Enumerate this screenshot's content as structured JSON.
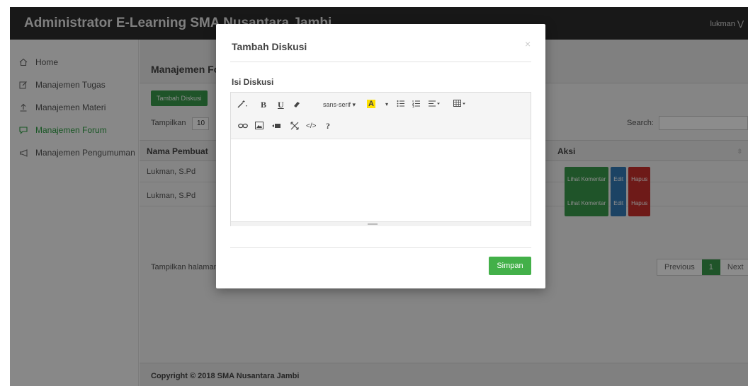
{
  "app": {
    "title": "Administrator E-Learning SMA Nusantara Jambi",
    "user": "lukman ⋁"
  },
  "sidebar": {
    "items": [
      {
        "label": "Home",
        "icon": "home-icon",
        "active": false
      },
      {
        "label": "Manajemen Tugas",
        "icon": "edit-icon",
        "active": false
      },
      {
        "label": "Manajemen Materi",
        "icon": "upload-icon",
        "active": false
      },
      {
        "label": "Manajemen Forum",
        "icon": "forum-icon",
        "active": true
      },
      {
        "label": "Manajemen Pengumuman",
        "icon": "megaphone-icon",
        "active": false
      }
    ]
  },
  "main": {
    "title": "Manajemen Forum",
    "add_button": "Tambah Diskusi",
    "length_label": "Tampilkan",
    "length_value": "10",
    "search_label": "Search:",
    "columns": [
      "Nama Pembuat",
      "Aksi"
    ],
    "rows": [
      {
        "nama": "Lukman, S.Pd"
      },
      {
        "nama": "Lukman, S.Pd"
      }
    ],
    "row_actions": {
      "comment": "Lihat Komentar",
      "edit": "Edit",
      "delete": "Hapus"
    },
    "info": "Tampilkan halaman",
    "pagination": {
      "prev": "Previous",
      "current": "1",
      "next": "Next"
    }
  },
  "footer": {
    "text": "Copyright © 2018 SMA Nusantara Jambi"
  },
  "modal": {
    "title": "Tambah Diskusi",
    "close": "×",
    "field_label": "Isi Diskusi",
    "font_name": "sans-serif ▾",
    "save_button": "Simpan"
  },
  "colors": {
    "accent_green": "#3a9a4c",
    "topbar": "#2d2d2d",
    "edit_blue": "#337ab7",
    "delete_red": "#c9302c"
  }
}
